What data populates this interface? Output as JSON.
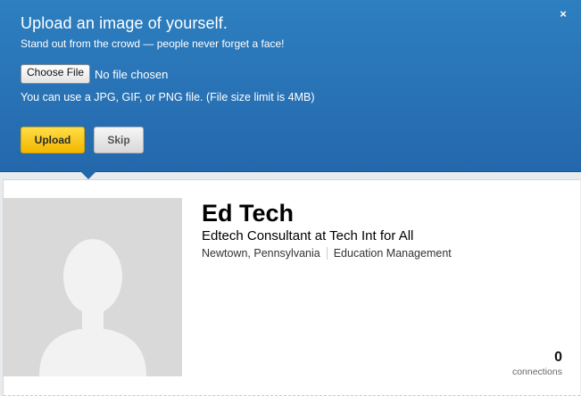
{
  "upload_banner": {
    "title": "Upload an image of yourself.",
    "subtitle": "Stand out from the crowd — people never forget a face!",
    "choose_file_label": "Choose File",
    "no_file_text": "No file chosen",
    "file_limit_text": "You can use a JPG, GIF, or PNG file. (File size limit is 4MB)",
    "upload_label": "Upload",
    "skip_label": "Skip",
    "close_symbol": "×"
  },
  "profile": {
    "name": "Ed Tech",
    "headline": "Edtech Consultant at Tech Int for All",
    "location": "Newtown, Pennsylvania",
    "industry": "Education Management",
    "connections_count": "0",
    "connections_label": "connections"
  },
  "colors": {
    "banner_blue": "#2468ac",
    "upload_yellow": "#f2b600",
    "avatar_bg": "#d9d9d9",
    "silhouette": "#f2f2f2"
  },
  "icons": {
    "close": "close-icon",
    "avatar": "avatar-silhouette-icon"
  }
}
